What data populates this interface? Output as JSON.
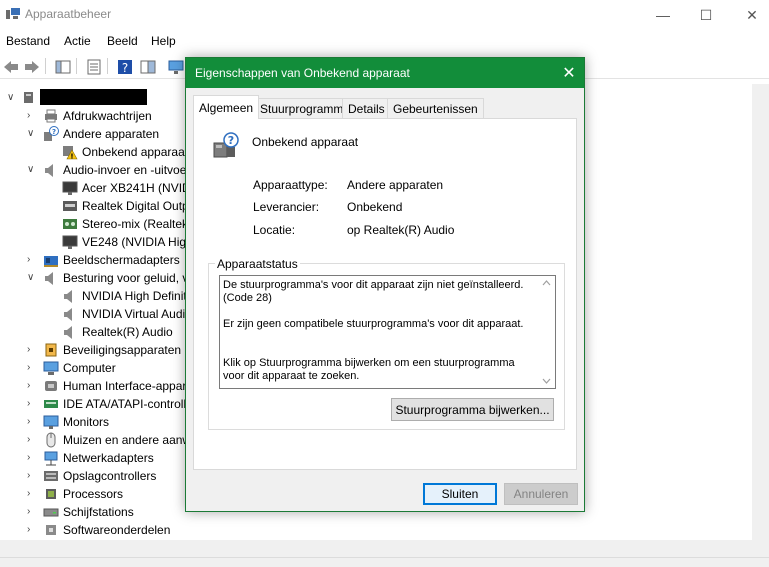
{
  "window": {
    "title": "Apparaatbeheer",
    "min_glyph": "—",
    "max_glyph": "☐",
    "close_glyph": "✕"
  },
  "menu": [
    "Bestand",
    "Actie",
    "Beeld",
    "Help"
  ],
  "tree": {
    "collapse_glyph": "∨",
    "expand_glyph": "›",
    "items": [
      {
        "label": "Afdrukwachtrijen",
        "icon": "printer-icon",
        "level": 1,
        "expander": "collapsed"
      },
      {
        "label": "Andere apparaten",
        "icon": "unknown-devices-icon",
        "level": 1,
        "expander": "expanded"
      },
      {
        "label": "Onbekend apparaat",
        "icon": "warning-device-icon",
        "level": 2,
        "expander": "none"
      },
      {
        "label": "Audio-invoer en -uitvoer",
        "icon": "speaker-icon",
        "level": 1,
        "expander": "expanded"
      },
      {
        "label": "Acer XB241H (NVIDIA High Definition Audio)",
        "icon": "monitor-audio-icon",
        "level": 2,
        "expander": "none"
      },
      {
        "label": "Realtek Digital Output (Realtek(R) Audio)",
        "icon": "digital-output-icon",
        "level": 2,
        "expander": "none"
      },
      {
        "label": "Stereo-mix (Realtek(R) Audio)",
        "icon": "stereo-mix-icon",
        "level": 2,
        "expander": "none"
      },
      {
        "label": "VE248 (NVIDIA High Definition Audio)",
        "icon": "monitor-audio-icon",
        "level": 2,
        "expander": "none"
      },
      {
        "label": "Beeldschermadapters",
        "icon": "display-adapter-icon",
        "level": 1,
        "expander": "collapsed"
      },
      {
        "label": "Besturing voor geluid, video en spelletjes",
        "icon": "speaker-icon",
        "level": 1,
        "expander": "expanded"
      },
      {
        "label": "NVIDIA High Definition Audio",
        "icon": "speaker-icon",
        "level": 2,
        "expander": "none"
      },
      {
        "label": "NVIDIA Virtual Audio Device",
        "icon": "speaker-icon",
        "level": 2,
        "expander": "none"
      },
      {
        "label": "Realtek(R) Audio",
        "icon": "speaker-icon",
        "level": 2,
        "expander": "none"
      },
      {
        "label": "Beveiligingsapparaten",
        "icon": "security-device-icon",
        "level": 1,
        "expander": "collapsed"
      },
      {
        "label": "Computer",
        "icon": "computer-icon",
        "level": 1,
        "expander": "collapsed"
      },
      {
        "label": "Human Interface-apparaten",
        "icon": "hid-icon",
        "level": 1,
        "expander": "collapsed"
      },
      {
        "label": "IDE ATA/ATAPI-controllers",
        "icon": "ide-controller-icon",
        "level": 1,
        "expander": "collapsed"
      },
      {
        "label": "Monitors",
        "icon": "monitor-icon",
        "level": 1,
        "expander": "collapsed"
      },
      {
        "label": "Muizen en andere aanwijsapparaten",
        "icon": "mouse-icon",
        "level": 1,
        "expander": "collapsed"
      },
      {
        "label": "Netwerkadapters",
        "icon": "network-adapter-icon",
        "level": 1,
        "expander": "collapsed"
      },
      {
        "label": "Opslagcontrollers",
        "icon": "storage-controller-icon",
        "level": 1,
        "expander": "collapsed"
      },
      {
        "label": "Processors",
        "icon": "processor-icon",
        "level": 1,
        "expander": "collapsed"
      },
      {
        "label": "Schijfstations",
        "icon": "disk-drive-icon",
        "level": 1,
        "expander": "collapsed"
      },
      {
        "label": "Softwareonderdelen",
        "icon": "software-component-icon",
        "level": 1,
        "expander": "collapsed"
      }
    ]
  },
  "dialog": {
    "title": "Eigenschappen van Onbekend apparaat",
    "close_glyph": "✕",
    "tabs": [
      {
        "label": "Algemeen",
        "active": true
      },
      {
        "label": "Stuurprogramma",
        "active": false
      },
      {
        "label": "Details",
        "active": false
      },
      {
        "label": "Gebeurtenissen",
        "active": false
      }
    ],
    "device_name": "Onbekend apparaat",
    "properties": [
      {
        "label": "Apparaattype:",
        "value": "Andere apparaten"
      },
      {
        "label": "Leverancier:",
        "value": "Onbekend"
      },
      {
        "label": "Locatie:",
        "value": "op Realtek(R) Audio"
      }
    ],
    "status_group_label": "Apparaatstatus",
    "status_paragraphs": [
      "De stuurprogramma's voor dit apparaat zijn niet geïnstalleerd. (Code 28)",
      "Er zijn geen compatibele stuurprogramma's voor dit apparaat.",
      "Klik op Stuurprogramma bijwerken om een stuurprogramma voor dit apparaat te zoeken."
    ],
    "update_button": "Stuurprogramma bijwerken...",
    "ok_button": "Sluiten",
    "cancel_button": "Annuleren"
  },
  "colors": {
    "dialog_title_bg": "#128d3a",
    "dialog_border": "#1b7a36",
    "focus_blue": "#0078d7"
  }
}
